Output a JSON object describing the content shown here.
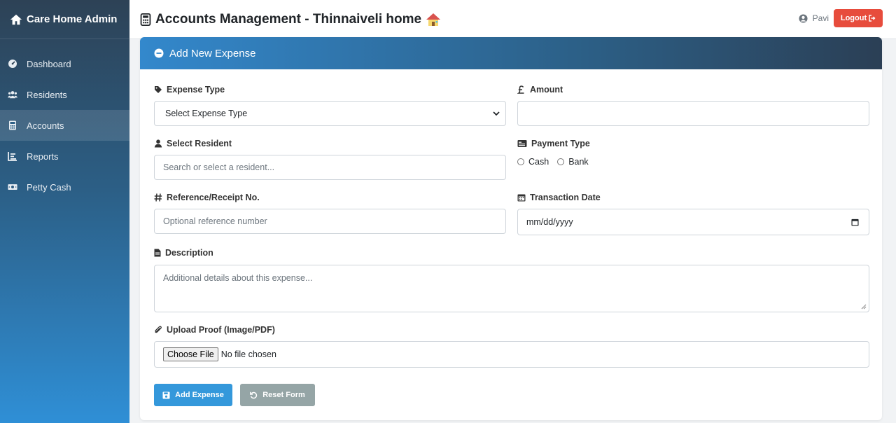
{
  "sidebar": {
    "brand": "Care Home Admin",
    "items": [
      {
        "label": "Dashboard",
        "icon": "dashboard-icon"
      },
      {
        "label": "Residents",
        "icon": "users-icon"
      },
      {
        "label": "Accounts",
        "icon": "calculator-icon"
      },
      {
        "label": "Reports",
        "icon": "chart-icon"
      },
      {
        "label": "Petty Cash",
        "icon": "money-icon"
      }
    ],
    "active_index": 2
  },
  "header": {
    "title": "Accounts Management - Thinnaiveli home",
    "user": "Pavi",
    "logout_label": "Logout"
  },
  "form": {
    "card_title": "Add New Expense",
    "expense_type": {
      "label": "Expense Type",
      "value": "Select Expense Type"
    },
    "amount": {
      "label": "Amount",
      "value": ""
    },
    "resident": {
      "label": "Select Resident",
      "placeholder": "Search or select a resident..."
    },
    "payment_type": {
      "label": "Payment Type",
      "options": [
        "Cash",
        "Bank"
      ]
    },
    "reference": {
      "label": "Reference/Receipt No.",
      "placeholder": "Optional reference number"
    },
    "date": {
      "label": "Transaction Date",
      "value": "mm/dd/yyyy"
    },
    "description": {
      "label": "Description",
      "placeholder": "Additional details about this expense..."
    },
    "upload": {
      "label": "Upload Proof (Image/PDF)",
      "button": "Choose File",
      "status": "No file chosen"
    },
    "submit_label": "Add Expense",
    "reset_label": "Reset Form"
  },
  "colors": {
    "accent": "#3388cc",
    "primary_button": "#3498db",
    "secondary_button": "#95a5a6",
    "danger": "#e74c3c"
  }
}
